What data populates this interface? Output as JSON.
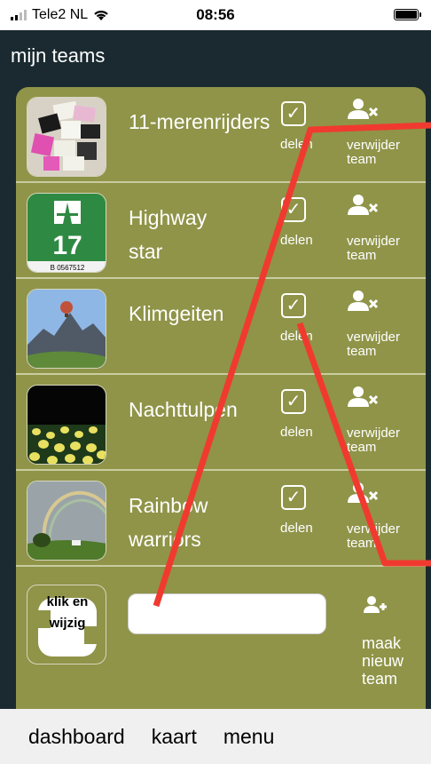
{
  "status_bar": {
    "carrier": "Tele2 NL",
    "time": "08:56"
  },
  "header": {
    "title": "mijn teams"
  },
  "teams": [
    {
      "name": "11-merenrijders",
      "share_label": "delen",
      "remove_label": "verwijder team",
      "shared": true,
      "photo_icon": "candy-photo"
    },
    {
      "name": "Highway star",
      "share_label": "delen",
      "remove_label": "verwijder team",
      "shared": true,
      "photo_icon": "highway-sign-photo"
    },
    {
      "name": "Klimgeiten",
      "share_label": "delen",
      "remove_label": "verwijder team",
      "shared": true,
      "photo_icon": "balloon-mountain-photo"
    },
    {
      "name": "Nachttulpen",
      "share_label": "delen",
      "remove_label": "verwijder team",
      "shared": true,
      "photo_icon": "tulips-photo"
    },
    {
      "name": "Rainbow warriors",
      "share_label": "delen",
      "remove_label": "verwijder team",
      "shared": true,
      "photo_icon": "rainbow-photo"
    }
  ],
  "new_team": {
    "thumb_label": "klik en wijzig",
    "input_value": "",
    "add_label": "maak nieuw team"
  },
  "bottom_nav": {
    "items": [
      "dashboard",
      "kaart",
      "menu"
    ]
  },
  "colors": {
    "card": "#8f9448",
    "background": "#1a2a30",
    "annotation": "#f03a30"
  }
}
